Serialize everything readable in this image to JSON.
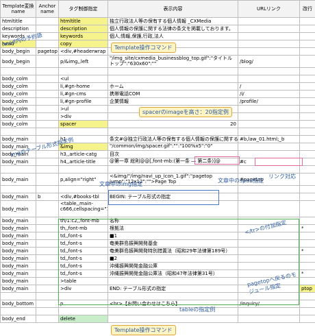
{
  "headers": {
    "template": "Template変換name",
    "anchor": "Anchor name",
    "tag": "タグ制御指定",
    "display": "表示内容",
    "url": "URLリンク",
    "break": "改行"
  },
  "rows": [
    {
      "c0": "htmltitle",
      "c1": "",
      "c2": "htmltitle",
      "c3": "独立行政法人等の保有する個人情報 _CXMedia",
      "c4": "",
      "c5": ""
    },
    {
      "c0": "description",
      "c1": "",
      "c2": "description",
      "c3": "個人情報の保護に関する法律の条文を掲載しております。",
      "c4": "",
      "c5": ""
    },
    {
      "c0": "keywords",
      "c1": "",
      "c2": "keywords",
      "c3": "個人,情報,保護,行政,法人",
      "c4": "",
      "c5": ""
    },
    {
      "c0": "head",
      "c1": "",
      "c2": "copy",
      "c3": "",
      "c4": "",
      "c5": ""
    },
    {
      "c0": "body_begin",
      "c1": "pagetop",
      "c2": "<div,#headerwrap",
      "c3": "",
      "c4": "",
      "c5": ""
    },
    {
      "c0": "body_begin",
      "c1": "",
      "c2": "p/&img,,left",
      "c3": "\"/img_site/cxmedia_businessblog_top.gif\":\"タイトルトップ\":\"630x60\":\"\"",
      "c4": "/blog/",
      "c5": ""
    },
    {
      "c0": "",
      "c1": "",
      "c2": "",
      "c3": "",
      "c4": "",
      "c5": ""
    },
    {
      "c0": "body_colm",
      "c1": "",
      "c2": "<ul",
      "c3": "",
      "c4": "",
      "c5": ""
    },
    {
      "c0": "body_colm",
      "c1": "",
      "c2": "li,#gn-home",
      "c3": "ホーム",
      "c4": "/",
      "c5": ""
    },
    {
      "c0": "body_colm",
      "c1": "",
      "c2": "li,#gn-cms",
      "c3": "携帯電話COM",
      "c4": "/i/",
      "c5": ""
    },
    {
      "c0": "body_colm",
      "c1": "",
      "c2": "li,#gn-profile",
      "c3": "企業情報",
      "c4": "/profile/",
      "c5": ""
    },
    {
      "c0": "body_colm",
      "c1": "",
      "c2": ">ul",
      "c3": "",
      "c4": "",
      "c5": ""
    },
    {
      "c0": "body_colm",
      "c1": "",
      "c2": ">div",
      "c3": "",
      "c4": "",
      "c5": ""
    },
    {
      "c0": "body_colm",
      "c1": "",
      "c2": "spacer",
      "c3": "",
      "c3num": "20",
      "c4": "",
      "c5": ""
    },
    {
      "c0": "",
      "c1": "",
      "c2": "",
      "c3": "",
      "c4": "",
      "c5": ""
    },
    {
      "c0": "body_main",
      "c1": "",
      "c2": "h1",
      "c3": "条文#@独立行政法人等の保有する個人情報の保護に関する法律",
      "c4": "#b,law_01.html;_b",
      "c5": ""
    },
    {
      "c0": "body_main",
      "c1": "",
      "c2": "&img",
      "c3": "\"/common/img/spacer.gif\":\"\":\"100%x5\":\"0\"",
      "c4": "",
      "c5": ""
    },
    {
      "c0": "body_main",
      "c1": "",
      "c2": "h3,,article-catg",
      "c3": "目次",
      "c4": "",
      "c5": ""
    },
    {
      "c0": "body_main",
      "c1": "",
      "c2": "h4,,article-title",
      "c3": "@第一章 総則@@[,font-mb:(第一条 ― 第二条)]@",
      "c4": "#c",
      "c5": ""
    },
    {
      "c0": "",
      "c1": "",
      "c2": "",
      "c3": "",
      "c4": "",
      "c5": ""
    },
    {
      "c0": "body_main",
      "c1": "",
      "c2": "p,align=\"right\"",
      "c3": "<&img/\"/img/navi_up_icon_1.gif\":\"pagetop jump\":\"12x12\":\"\">Page Top",
      "c4": "#pagetop",
      "c5": ""
    },
    {
      "c0": "",
      "c1": "",
      "c2": "",
      "c3": "",
      "c4": "",
      "c5": ""
    },
    {
      "c0": "body_main",
      "c1": "b",
      "c2": "<div,#books-tbl",
      "c3": "BEGIN: テーブル形式の指定",
      "c4": "",
      "c5": ""
    },
    {
      "c0": "body_main",
      "c1": "",
      "c2": "<table,,main-c666,cellspacing=\"1\",cellpadding=\"2\"",
      "c3": "",
      "c4": "",
      "c5": ""
    },
    {
      "c0": "body_main",
      "c1": "",
      "c2": "th/1:c2,,font-mb",
      "c3": "名称",
      "c4": "",
      "c5": ""
    },
    {
      "c0": "body_main",
      "c1": "",
      "c2": "th,,font-mb",
      "c3": "根拠法",
      "c4": "",
      "c5": "*"
    },
    {
      "c0": "body_main",
      "c1": "",
      "c2": "td,,font-s",
      "c3": "■1",
      "c4": "",
      "c5": ""
    },
    {
      "c0": "body_main",
      "c1": "",
      "c2": "td,,font-s",
      "c3": "奄美群島振興開発基金",
      "c4": "",
      "c5": ""
    },
    {
      "c0": "body_main",
      "c1": "",
      "c2": "td,,font-s",
      "c3": "奄美群島振興開発特別措置法（昭和29年法律第189号）",
      "c4": "",
      "c5": "*"
    },
    {
      "c0": "body_main",
      "c1": "",
      "c2": "td,,font-s",
      "c3": "■2",
      "c4": "",
      "c5": ""
    },
    {
      "c0": "body_main",
      "c1": "",
      "c2": "td,,font-s",
      "c3": "沖縄振興開発金融公庫",
      "c4": "",
      "c5": ""
    },
    {
      "c0": "body_main",
      "c1": "",
      "c2": "td,,font-s",
      "c3": "沖縄振興開発金融公庫法（昭和47年法律第31号）",
      "c4": "",
      "c5": "*"
    },
    {
      "c0": "body_main",
      "c1": "",
      "c2": ">table",
      "c3": "",
      "c4": "",
      "c5": ""
    },
    {
      "c0": "body_main",
      "c1": "",
      "c2": ">div",
      "c3": "END: テーブル形式の指定",
      "c4": "",
      "c5": "ptop"
    },
    {
      "c0": "",
      "c1": "",
      "c2": "",
      "c3": "",
      "c4": "",
      "c5": ""
    },
    {
      "c0": "body_bottom",
      "c1": "",
      "c2": "p",
      "c3": "<br>【お問い合わせはこちら】",
      "c4": "/inquiry/",
      "c5": ""
    },
    {
      "c0": "",
      "c1": "",
      "c2": "",
      "c3": "",
      "c4": "",
      "c5": ""
    },
    {
      "c0": "body_end",
      "c1": "",
      "c2": "delete",
      "c3": "",
      "c4": "",
      "c5": ""
    }
  ],
  "callouts": {
    "template_copy": "Template操作コマンド",
    "head_reserved": "head内の予約語",
    "spacer_img": "spacerのimageを高さ：20指定例",
    "img_table": "imgのテーブル形式指定例",
    "link_support": "リンク対応",
    "img_in_text": "文章中のimg指定",
    "span_in_text": "文章中のspan指定",
    "tr_add": "</tr>の付加指定",
    "pagetop_module": "pagetopへ戻るのモジュール指定",
    "table_example": "tableの指定例",
    "template_delete": "Template操作コマンド"
  },
  "colors": {
    "highlight_yellow": "#f6f28c",
    "highlight_green": "#c9ecc9",
    "callout_text": "#2c5aa0",
    "callout_border": "#e0a53a"
  }
}
